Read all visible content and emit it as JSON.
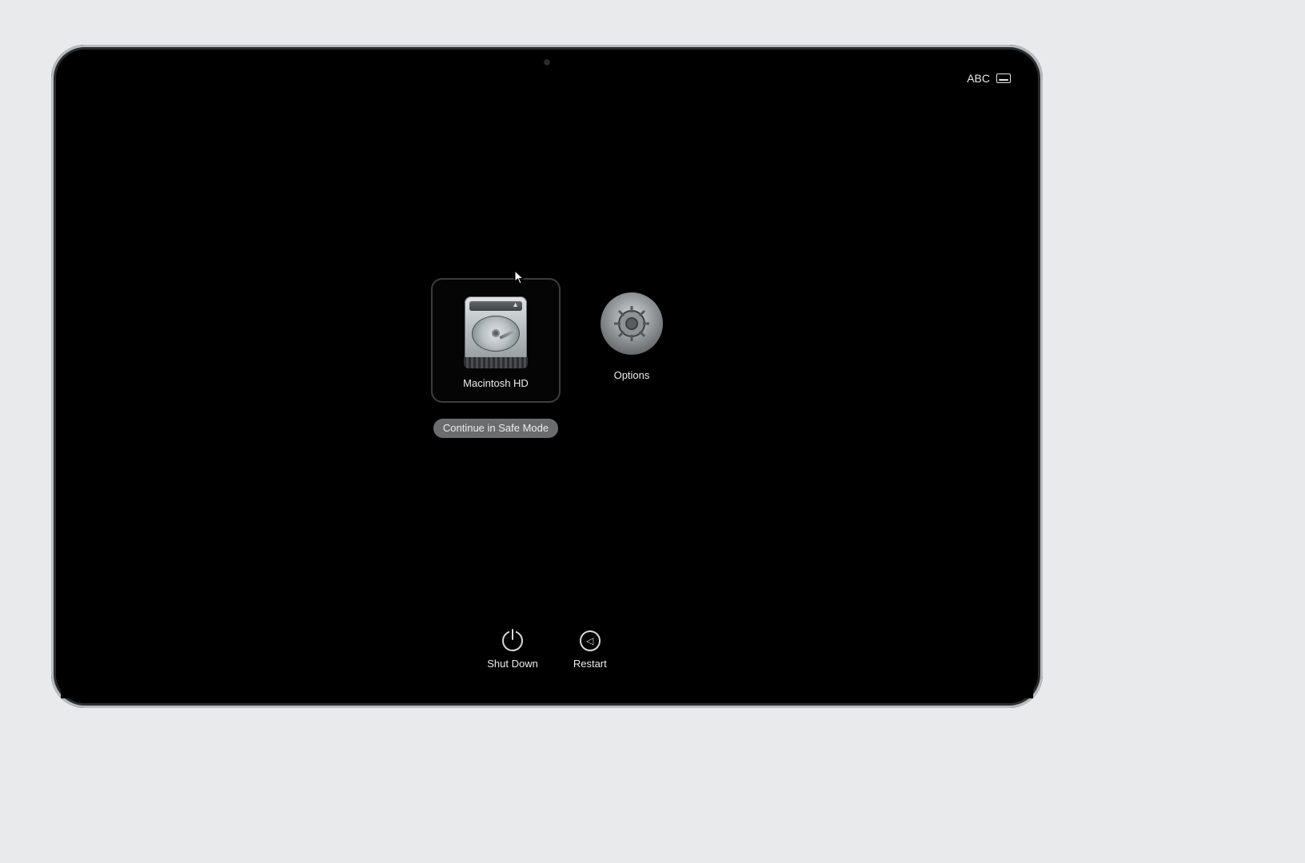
{
  "status": {
    "input_label": "ABC"
  },
  "startup": {
    "disk_label": "Macintosh HD",
    "options_label": "Options",
    "safe_mode_button": "Continue in Safe Mode"
  },
  "bottom": {
    "shutdown_label": "Shut Down",
    "restart_label": "Restart"
  },
  "icons": {
    "hard_drive": "hard-drive-icon",
    "gear": "gear-icon",
    "power": "power-icon",
    "restart": "restart-icon",
    "keyboard": "keyboard-icon"
  }
}
